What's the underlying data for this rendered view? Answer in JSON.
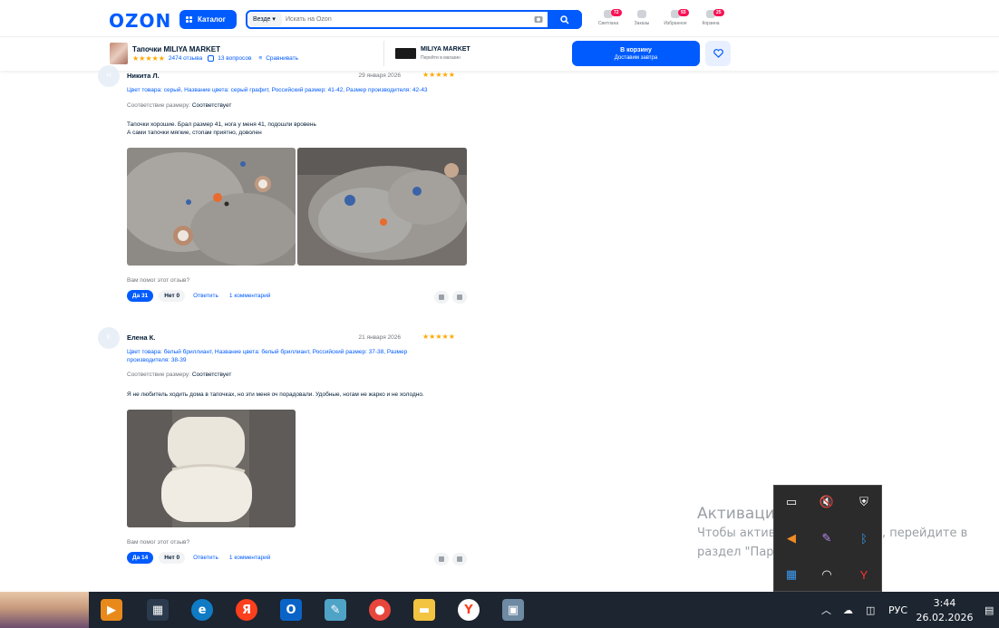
{
  "header": {
    "logo": "OZON",
    "catalog_label": "Каталог",
    "search_scope": "Везде",
    "search_placeholder": "Искать на Ozon",
    "icons": [
      {
        "label": "Светлана",
        "badge": "72",
        "icon": "user-icon"
      },
      {
        "label": "Заказы",
        "badge": "",
        "icon": "box-icon"
      },
      {
        "label": "Избранное",
        "badge": "93",
        "icon": "heart-icon"
      },
      {
        "label": "Корзина",
        "badge": "25",
        "icon": "cart-icon"
      }
    ]
  },
  "product_bar": {
    "title": "Тапочки MILIYA MARKET",
    "stars": "★★★★★",
    "reviews_link": "2474 отзыва",
    "questions_link": "13 вопросов",
    "compare_link": "Сравнивать",
    "seller_name": "MILIYA MARKET",
    "seller_sub": "Перейти в магазин",
    "cart_button": "В корзину",
    "cart_sub": "Доставим завтра"
  },
  "reviews": [
    {
      "author": "Никита Л.",
      "date": "29 января 2026",
      "stars": "★★★★★",
      "props": "Цвет товара: серый, Название цвета: серый графит, Российский размер: 41-42, Размер производителя: 42-43",
      "size_label": "Соответствие размеру:",
      "size_value": "Соответствует",
      "text_line1": "Тапочки хорошие. Брал размер 41, нога у меня 41, подошли вровень",
      "text_line2": "А сами тапочки мягкие, стопам приятно, доволен",
      "helpful_q": "Вам помог этот отзыв?",
      "yes": "Да 31",
      "no": "Нет 0",
      "reply": "Ответить",
      "comments": "1 комментарий"
    },
    {
      "author": "Елена К.",
      "date": "21 января 2026",
      "stars": "★★★★★",
      "props_line1": "Цвет товара: белый бриллиант, Название цвета: белый бриллиант, Российский размер: 37-38, Размер",
      "props_line2": "производителя: 38-39",
      "size_label": "Соответствие размеру:",
      "size_value": "Соответствует",
      "text_line1": "Я не любитель ходить дома в тапочках, но эти меня оч порадовали. Удобные, ногам не жарко и не холодно.",
      "helpful_q": "Вам помог этот отзыв?",
      "yes": "Да 14",
      "no": "Нет 0",
      "reply": "Ответить",
      "comments": "1 комментарий"
    }
  ],
  "watermark": {
    "title": "Активация Windows",
    "line1": "Чтобы активировать Windows, перейдите в",
    "line2": "раздел \"Параметры\"."
  },
  "taskbar": {
    "lang": "РУС",
    "time": "3:44",
    "date": "26.02.2026"
  },
  "colors": {
    "ozon_blue": "#005bff",
    "star": "#ffa800",
    "badge": "#f91155"
  }
}
